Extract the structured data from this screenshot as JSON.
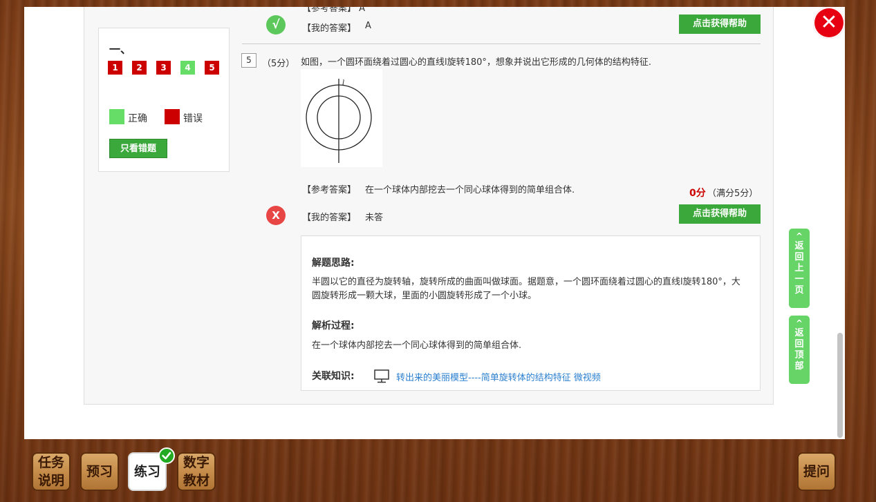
{
  "nav": {
    "title": "一、",
    "questions": [
      {
        "num": "1",
        "status": "wrong"
      },
      {
        "num": "2",
        "status": "wrong"
      },
      {
        "num": "3",
        "status": "wrong"
      },
      {
        "num": "4",
        "status": "right"
      },
      {
        "num": "5",
        "status": "wrong"
      }
    ],
    "legend_right": "正确",
    "legend_wrong": "错误",
    "wrong_only_button": "只看错题",
    "colors": {
      "right": "#66dd66",
      "wrong": "#cc0000"
    }
  },
  "prev_question": {
    "ref_label_cut": "【参考答案】 A",
    "mark": "√",
    "my_answer_label": "【我的答案】",
    "my_answer": "A",
    "help_button": "点击获得帮助"
  },
  "question": {
    "number": "5",
    "points": "（5分）",
    "text": "如图，一个圆环面绕着过圆心的直线l旋转180°，想象并说出它形成的几何体的结构特征.",
    "figure_axis_label": "l",
    "ref_answer_label": "【参考答案】",
    "ref_answer": "在一个球体内部挖去一个同心球体得到的简单组合体.",
    "score": "0分",
    "full_score": "（满分5分）",
    "mark": "X",
    "my_answer_label": "【我的答案】",
    "my_answer": "未答",
    "help_button": "点击获得帮助"
  },
  "explanation": {
    "idea_heading": "解题思路:",
    "idea_text": "半圆以它的直径为旋转轴，旋转所成的曲面叫做球面。据题意，一个圆环面绕着过圆心的直线l旋转180°，大圆旋转形成一颗大球，里面的小圆旋转形成了一个小球。",
    "process_heading": "解析过程:",
    "process_text": "在一个球体内部挖去一个同心球体得到的简单组合体.",
    "knowledge_heading": "关联知识:",
    "knowledge_icon": "monitor-icon",
    "knowledge_link": "转出来的美丽模型----简单旋转体的结构特征 微视频"
  },
  "side": {
    "back_prev": "返回上一页",
    "back_top": "返回顶部"
  },
  "close_icon": "close-icon",
  "bottom_tabs": [
    {
      "line1": "任务",
      "line2": "说明"
    },
    {
      "line1": "预习",
      "line2": ""
    },
    {
      "line1": "练习",
      "line2": ""
    },
    {
      "line1": "数字",
      "line2": "教材"
    }
  ],
  "ask_button": "提问",
  "accent": {
    "green": "#3aa83a",
    "red": "#e60012"
  }
}
